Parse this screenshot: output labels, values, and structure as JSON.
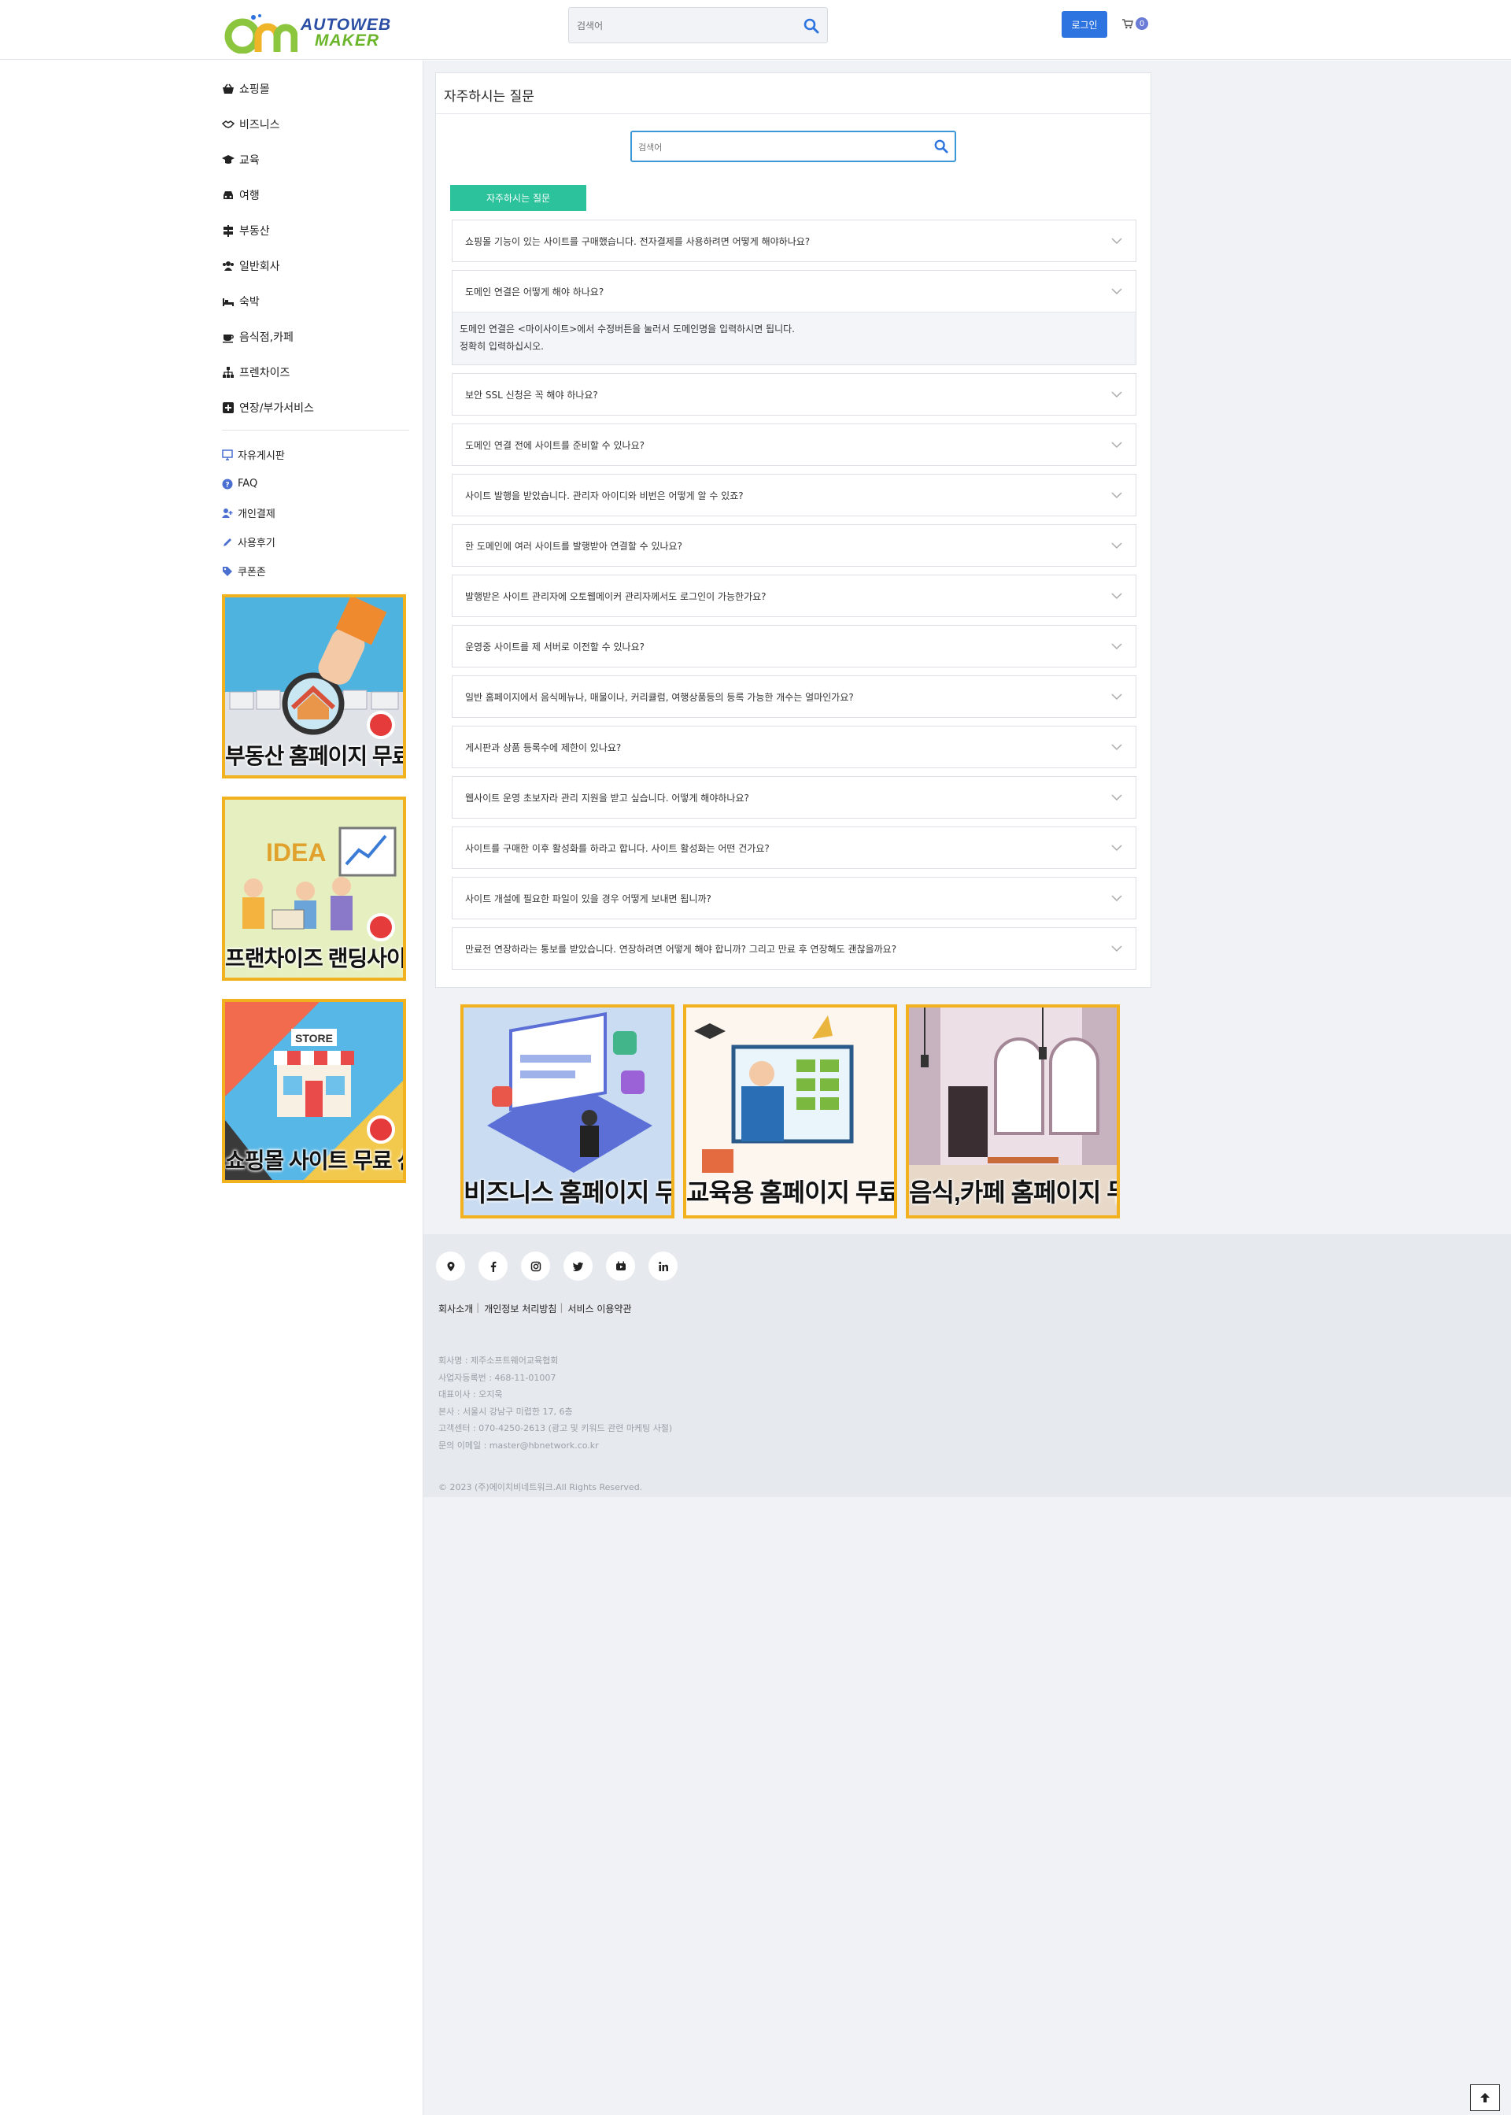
{
  "header": {
    "logo_line1": "AUTOWEB",
    "logo_line2": "MAKER",
    "search_placeholder": "검색어",
    "login_label": "로그인",
    "cart_count": "0"
  },
  "sidebar": {
    "categories": [
      {
        "label": "쇼핑몰",
        "icon": "basket-icon"
      },
      {
        "label": "비즈니스",
        "icon": "handshake-icon"
      },
      {
        "label": "교육",
        "icon": "graduation-cap-icon"
      },
      {
        "label": "여행",
        "icon": "car-icon"
      },
      {
        "label": "부동산",
        "icon": "signpost-icon"
      },
      {
        "label": "일반회사",
        "icon": "users-icon"
      },
      {
        "label": "숙박",
        "icon": "bed-icon"
      },
      {
        "label": "음식점,카페",
        "icon": "coffee-icon"
      },
      {
        "label": "프렌차이즈",
        "icon": "sitemap-icon"
      },
      {
        "label": "연장/부가서비스",
        "icon": "plus-square-icon"
      }
    ],
    "links": [
      {
        "label": "자유게시판",
        "icon": "desktop-icon"
      },
      {
        "label": "FAQ",
        "icon": "question-circle-icon"
      },
      {
        "label": "개인결제",
        "icon": "user-plus-icon"
      },
      {
        "label": "사용후기",
        "icon": "pencil-icon"
      },
      {
        "label": "쿠폰존",
        "icon": "tags-icon"
      }
    ],
    "banners": [
      {
        "caption": "부동산 홈페이지 무료 신청"
      },
      {
        "caption": "프랜차이즈 랜딩사이트 신청"
      },
      {
        "caption": "쇼핑몰 사이트 무료 신청"
      }
    ]
  },
  "faq": {
    "title": "자주하시는 질문",
    "search_placeholder": "검색어",
    "tab_label": "자주하시는 질문",
    "items": [
      {
        "question": "쇼핑몰 기능이 있는 사이트를 구매했습니다. 전자결제를 사용하려면 어떻게 해야하나요?"
      },
      {
        "question": "도메인 연결은 어떻게 해야 하나요?",
        "answer_line1": "도메인 연결은 <마이사이트>에서 수정버튼을 눌러서 도메인명을 입력하시면 됩니다.",
        "answer_line2": "정확히 입력하십시오."
      },
      {
        "question": "보안 SSL 신청은 꼭 해야 하나요?"
      },
      {
        "question": "도메인 연결 전에 사이트를 준비할 수 있나요?"
      },
      {
        "question": "사이트 발행을 받았습니다. 관리자 아이디와 비번은 어떻게 알 수 있죠?"
      },
      {
        "question": "한 도메인에 여러 사이트를 발행받아 연결할 수 있나요?"
      },
      {
        "question": "발행받은 사이트 관리자에 오토웹메이커 관리자께서도 로그인이 가능한가요?"
      },
      {
        "question": "운영중 사이트를 제 서버로 이전할 수 있나요?"
      },
      {
        "question": "일반 홈페이지에서 음식메뉴나, 매물이나, 커리큘럼, 여행상품등의 등록 가능한 개수는 얼마인가요?"
      },
      {
        "question": "게시판과 상품 등록수에 제한이 있나요?"
      },
      {
        "question": "웹사이트 운영 초보자라 관리 지원을 받고 싶습니다. 어떻게 해야하나요?"
      },
      {
        "question": "사이트를 구매한 이후 활성화를 하라고 합니다. 사이트 활성화는 어떤 건가요?"
      },
      {
        "question": "사이트 개설에 필요한 파일이 있을 경우 어떻게 보내면 됩니까?"
      },
      {
        "question": "만료전 연장하라는 통보를 받았습니다. 연장하려면 어떻게 해야 합니까? 그리고 만료 후 연장해도 괜찮을까요?"
      }
    ]
  },
  "bottom_banners": [
    {
      "caption": "비즈니스 홈페이지 무료 신청"
    },
    {
      "caption": "교육용 홈페이지 무료 신청"
    },
    {
      "caption": "음식,카페 홈페이지 무료 신청"
    }
  ],
  "footer": {
    "links": [
      "회사소개",
      "개인정보 처리방침",
      "서비스 이용약관"
    ],
    "info": [
      "회사명 : 제주소프트웨어교육협회",
      "사업자등록번 : 468-11-01007",
      "대표이사 : 오지욱",
      "본사 : 서울시 강남구 미렵한 17, 6층",
      "고객센터 : 070-4250-2613 (광고 및 키워드 관련 마케팅 사절)",
      "문의 이메일 : master@hbnetwork.co.kr"
    ],
    "copyright": "© 2023 (주)에이치비네트워크.All Rights Reserved."
  },
  "colors": {
    "accent_blue": "#2d74e0",
    "tab_green": "#2cc39c",
    "banner_border": "#f2b11f"
  }
}
